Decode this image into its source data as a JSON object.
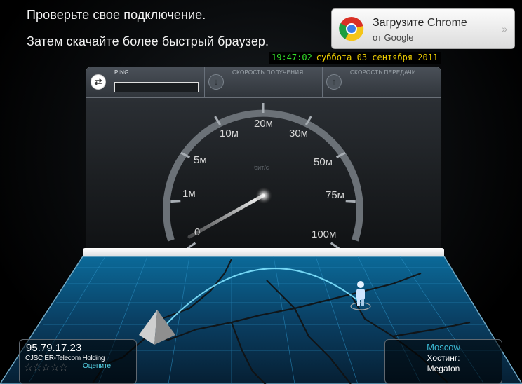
{
  "promo": {
    "line1": "Проверьте свое подключение.",
    "line2": "Затем скачайте более быстрый браузер."
  },
  "chrome_ad": {
    "title_strong": "Загрузите",
    "title_light": "Chrome",
    "subtitle": "от Google",
    "icon": "chrome-logo-icon",
    "chevron": "»"
  },
  "clock": {
    "time": "19:47:02",
    "date": "суббота 03 сентября 2011"
  },
  "tabs": {
    "ping": {
      "label": "PING",
      "icon": "arrows-swap-icon",
      "value": ""
    },
    "download": {
      "label": "СКОРОСТЬ ПОЛУЧЕНИЯ",
      "icon": "arrow-down-icon"
    },
    "upload": {
      "label": "СКОРОСТЬ ПЕРЕДАЧИ",
      "icon": "arrow-up-icon"
    }
  },
  "gauge": {
    "unit": "бит/с",
    "ticks": [
      "0",
      "1м",
      "5м",
      "10м",
      "20м",
      "30м",
      "50м",
      "75м",
      "100м"
    ]
  },
  "client": {
    "ip": "95.79.17.23",
    "isp": "CJSC ER-Telecom Holding",
    "stars": "☆☆☆☆☆",
    "rate_label": "Оцените"
  },
  "server": {
    "city": "Moscow",
    "host_label": "Хостинг:",
    "host": "Megafon"
  },
  "colors": {
    "accent_cyan": "#3bb9d4",
    "clock_time": "#33e22a",
    "clock_date": "#f0d000",
    "map_blue": "#0b5a8a"
  }
}
